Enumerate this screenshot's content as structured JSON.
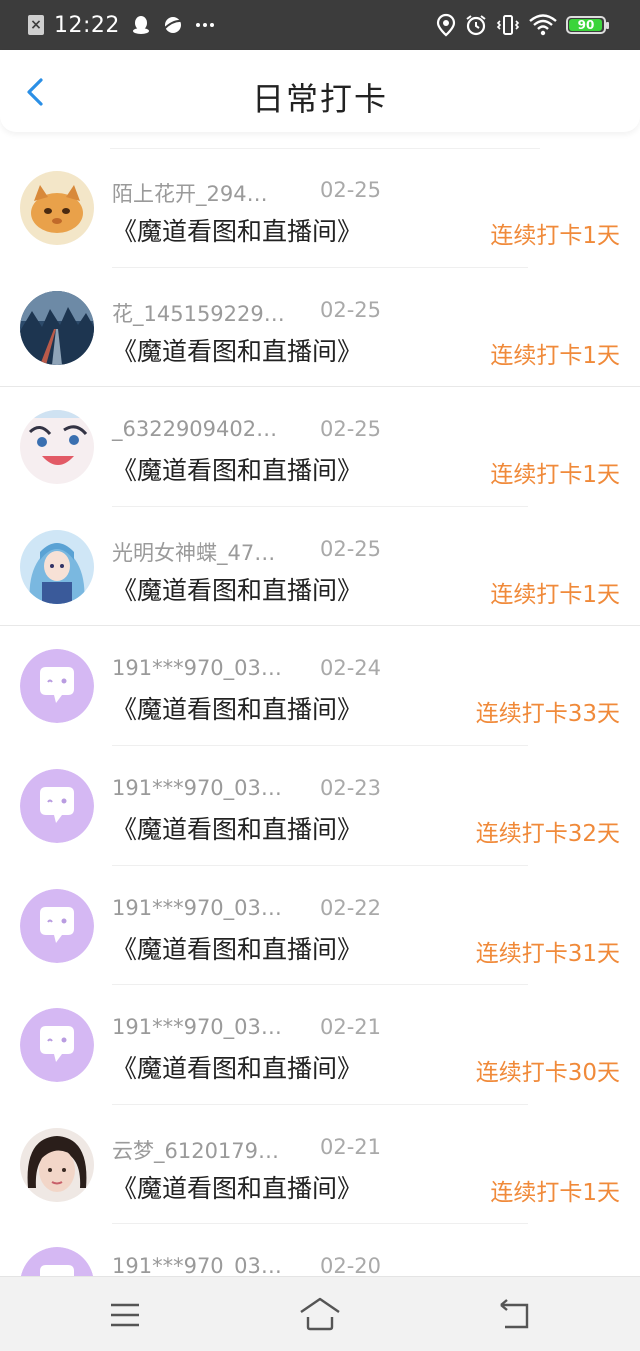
{
  "status_bar": {
    "time": "12:22",
    "battery": "90",
    "icons": [
      "close-box-icon",
      "qq-penguin-icon",
      "planet-icon",
      "more-dots-icon",
      "location-icon",
      "alarm-icon",
      "vibrate-icon",
      "wifi-icon",
      "battery-icon"
    ]
  },
  "header": {
    "title": "日常打卡",
    "back_icon": "chevron-left-icon"
  },
  "colors": {
    "accent": "#f08a3a",
    "back": "#2b8fe6",
    "status_bar": "#3c3c3c"
  },
  "checkins": [
    {
      "username": "陌上花开_294…",
      "date": "02-25",
      "book": "《魔道看图和直播间》",
      "streak": "连续打卡1天",
      "avatar": "cat-avatar"
    },
    {
      "username": "花_145159229…",
      "date": "02-25",
      "book": "《魔道看图和直播间》",
      "streak": "连续打卡1天",
      "avatar": "road-avatar"
    },
    {
      "username": "_6322909402…",
      "date": "02-25",
      "book": "《魔道看图和直播间》",
      "streak": "连续打卡1天",
      "avatar": "anime-face-avatar"
    },
    {
      "username": "光明女神蝶_47…",
      "date": "02-25",
      "book": "《魔道看图和直播间》",
      "streak": "连续打卡1天",
      "avatar": "anime-girl-avatar"
    },
    {
      "username": "191***970_03…",
      "date": "02-24",
      "book": "《魔道看图和直播间》",
      "streak": "连续打卡33天",
      "avatar": "default-chat-avatar"
    },
    {
      "username": "191***970_03…",
      "date": "02-23",
      "book": "《魔道看图和直播间》",
      "streak": "连续打卡32天",
      "avatar": "default-chat-avatar"
    },
    {
      "username": "191***970_03…",
      "date": "02-22",
      "book": "《魔道看图和直播间》",
      "streak": "连续打卡31天",
      "avatar": "default-chat-avatar"
    },
    {
      "username": "191***970_03…",
      "date": "02-21",
      "book": "《魔道看图和直播间》",
      "streak": "连续打卡30天",
      "avatar": "default-chat-avatar"
    },
    {
      "username": "云梦_6120179…",
      "date": "02-21",
      "book": "《魔道看图和直播间》",
      "streak": "连续打卡1天",
      "avatar": "girl-portrait-avatar"
    },
    {
      "username": "191***970_03…",
      "date": "02-20",
      "book": "",
      "streak": "",
      "avatar": "default-chat-avatar"
    }
  ],
  "bottom_nav": {
    "icons": [
      "menu-icon",
      "home-icon",
      "back-icon"
    ]
  }
}
